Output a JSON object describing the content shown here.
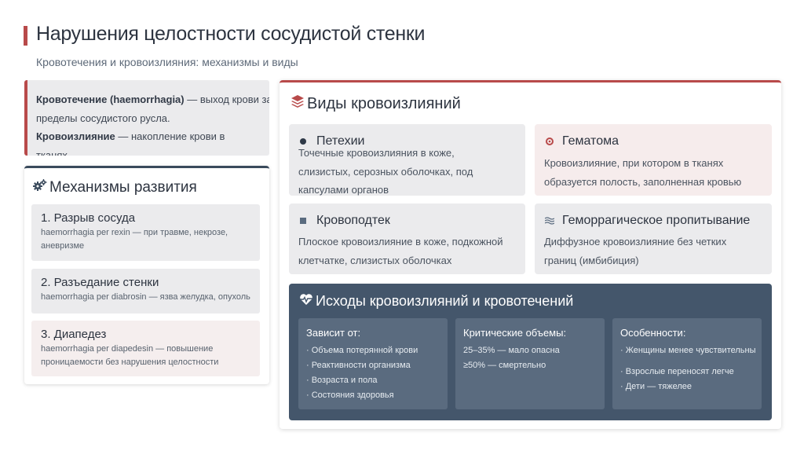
{
  "slide": {
    "title": "Нарушения целостности сосудистой стенки",
    "subtitle": "Кровотечения и кровоизлияния: механизмы и виды",
    "accent_color": "#b84a4a",
    "dark_color": "#44566b"
  },
  "definitions": {
    "bleeding_term": "Кровотечение (haemorrhagia)",
    "bleeding_text_1": " — выход крови за",
    "bleeding_text_2": "пределы сосудистого русла.",
    "hemorrhage_term": "Кровоизлияние",
    "hemorrhage_text_1": " — накопление крови в",
    "hemorrhage_text_2": "тканях."
  },
  "mechanisms": {
    "title": "Механизмы развития",
    "icon": "gears-icon",
    "items": [
      {
        "title": "1. Разрыв сосуда",
        "desc_1": "haemorrhagia per rexin — при травме, некрозе,",
        "desc_2": "аневризме"
      },
      {
        "title": "2. Разъедание стенки",
        "desc_1": "haemorrhagia per diabrosin — язва желудка, опухоль",
        "desc_2": ""
      },
      {
        "title": "3. Диапедез",
        "desc_1": "haemorrhagia per diapedesin — повышение",
        "desc_2": "проницаемости без нарушения целостности"
      }
    ]
  },
  "types": {
    "title": "Виды кровоизлияний",
    "icon": "layers-icon",
    "cards": [
      {
        "title": "Петехии",
        "icon": "dot-icon",
        "desc_1": "Точечные кровоизлияния в коже,",
        "desc_2": "слизистых, серозных оболочках, под",
        "desc_3": "капсулами органов"
      },
      {
        "title": "Гематома",
        "icon": "ring-icon",
        "desc_1": "Кровоизлияние, при котором в тканях",
        "desc_2": "образуется полость, заполненная кровью",
        "desc_3": ""
      },
      {
        "title": "Кровоподтек",
        "icon": "square-icon",
        "desc_1": "Плоское кровоизлияние в коже, подкожной",
        "desc_2": "клетчатке, слизистых оболочках",
        "desc_3": ""
      },
      {
        "title": "Геморрагическое пропитывание",
        "icon": "waves-icon",
        "desc_1": "Диффузное кровоизлияние без четких",
        "desc_2": "границ (имбибиция)",
        "desc_3": ""
      }
    ]
  },
  "outcomes": {
    "title": "Исходы кровоизлияний и кровотечений",
    "icon": "heart-pulse-icon",
    "columns": [
      {
        "title": "Зависит от:",
        "items": [
          "· Объема потерянной крови",
          "· Реактивности организма",
          "· Возраста и пола",
          "· Состояния здоровья"
        ]
      },
      {
        "title": "Критические объемы:",
        "items": [
          "25–35% — мало опасна",
          "≥50% — смертельно"
        ]
      },
      {
        "title": "Особенности:",
        "items": [
          "· Женщины менее чувствительны",
          "· Взрослые переносят легче",
          "· Дети — тяжелее"
        ]
      }
    ]
  }
}
